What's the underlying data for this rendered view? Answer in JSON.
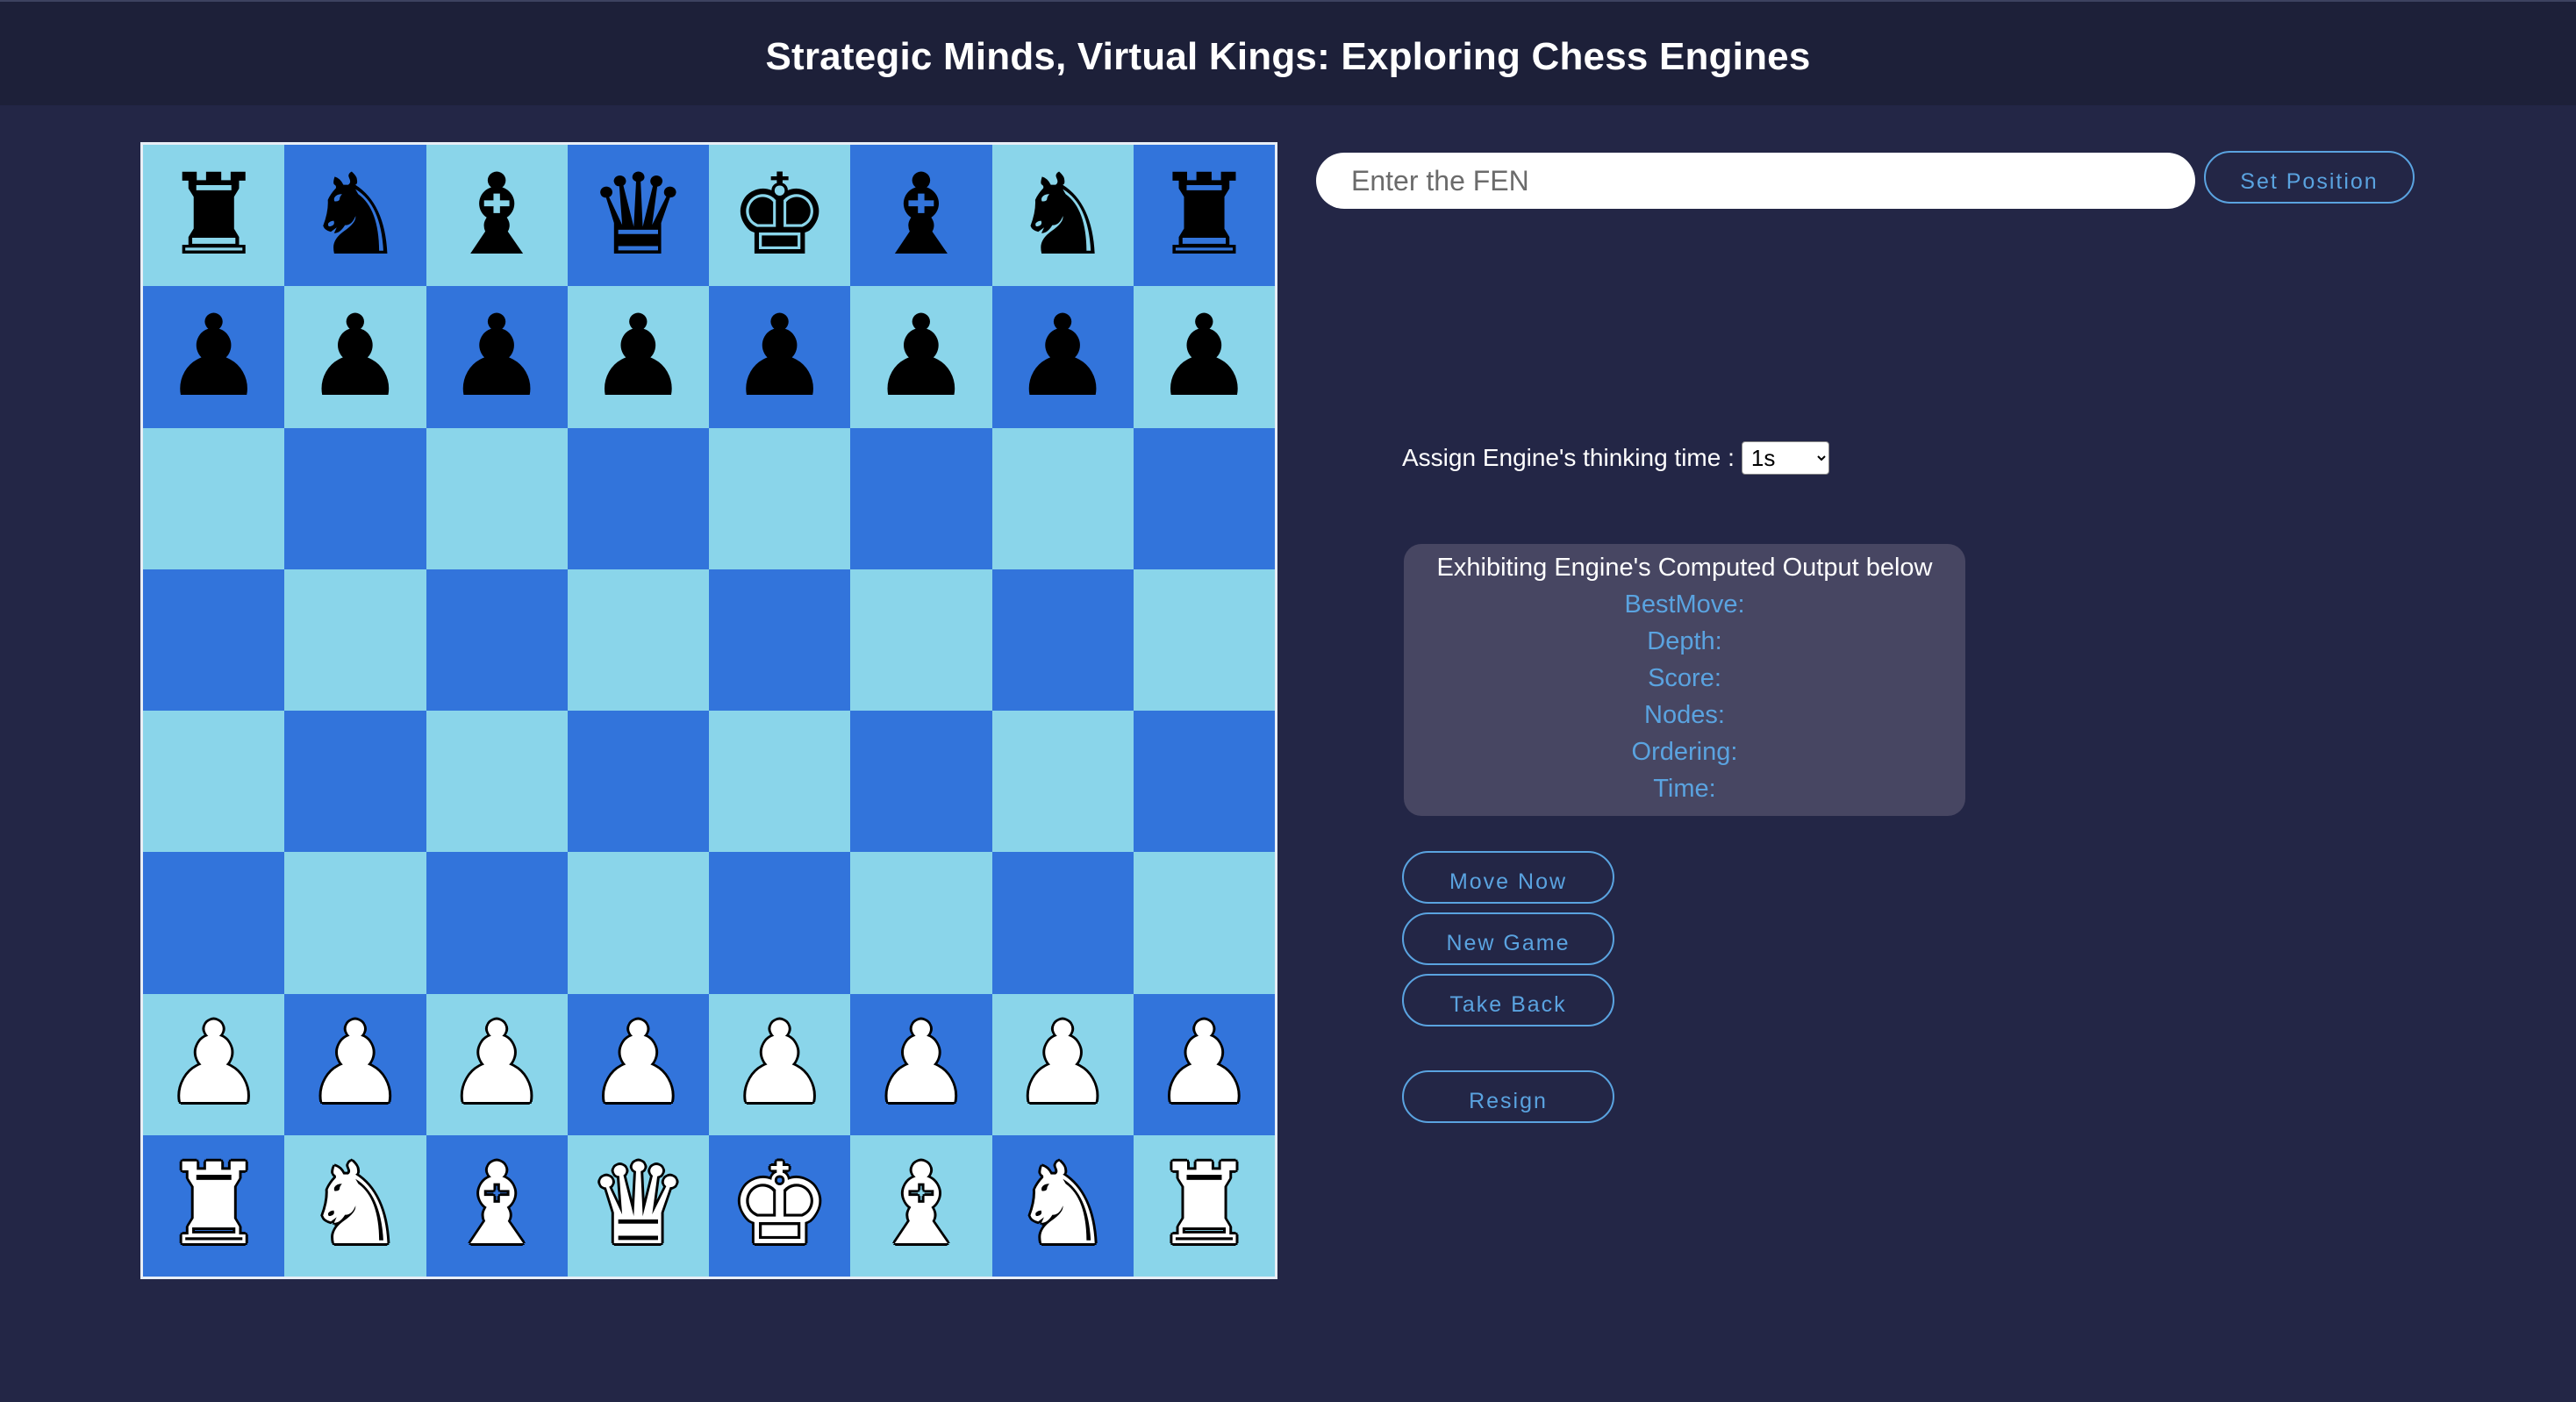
{
  "header": {
    "title": "Strategic Minds, Virtual Kings: Exploring Chess Engines"
  },
  "board": {
    "light_color": "#8ad5ea",
    "dark_color": "#3274db",
    "ranks": [
      [
        "r",
        "n",
        "b",
        "q",
        "k",
        "b",
        "n",
        "r"
      ],
      [
        "p",
        "p",
        "p",
        "p",
        "p",
        "p",
        "p",
        "p"
      ],
      [
        "",
        "",
        "",
        "",
        "",
        "",
        "",
        ""
      ],
      [
        "",
        "",
        "",
        "",
        "",
        "",
        "",
        ""
      ],
      [
        "",
        "",
        "",
        "",
        "",
        "",
        "",
        ""
      ],
      [
        "",
        "",
        "",
        "",
        "",
        "",
        "",
        ""
      ],
      [
        "P",
        "P",
        "P",
        "P",
        "P",
        "P",
        "P",
        "P"
      ],
      [
        "R",
        "N",
        "B",
        "Q",
        "K",
        "B",
        "N",
        "R"
      ]
    ]
  },
  "fen": {
    "placeholder": "Enter the FEN",
    "value": "",
    "set_button": "Set Position"
  },
  "thinking_time": {
    "label": "Assign Engine's thinking time :",
    "selected": "1s",
    "options": [
      "1s"
    ]
  },
  "output": {
    "title": "Exhibiting Engine's Computed Output below",
    "lines": [
      "BestMove:",
      "Depth:",
      "Score:",
      "Nodes:",
      "Ordering:",
      "Time:"
    ]
  },
  "controls": {
    "move_now": "Move Now",
    "new_game": "New Game",
    "take_back": "Take Back",
    "resign": "Resign"
  },
  "colors": {
    "background": "#232646",
    "accent": "#5aa3e0"
  }
}
